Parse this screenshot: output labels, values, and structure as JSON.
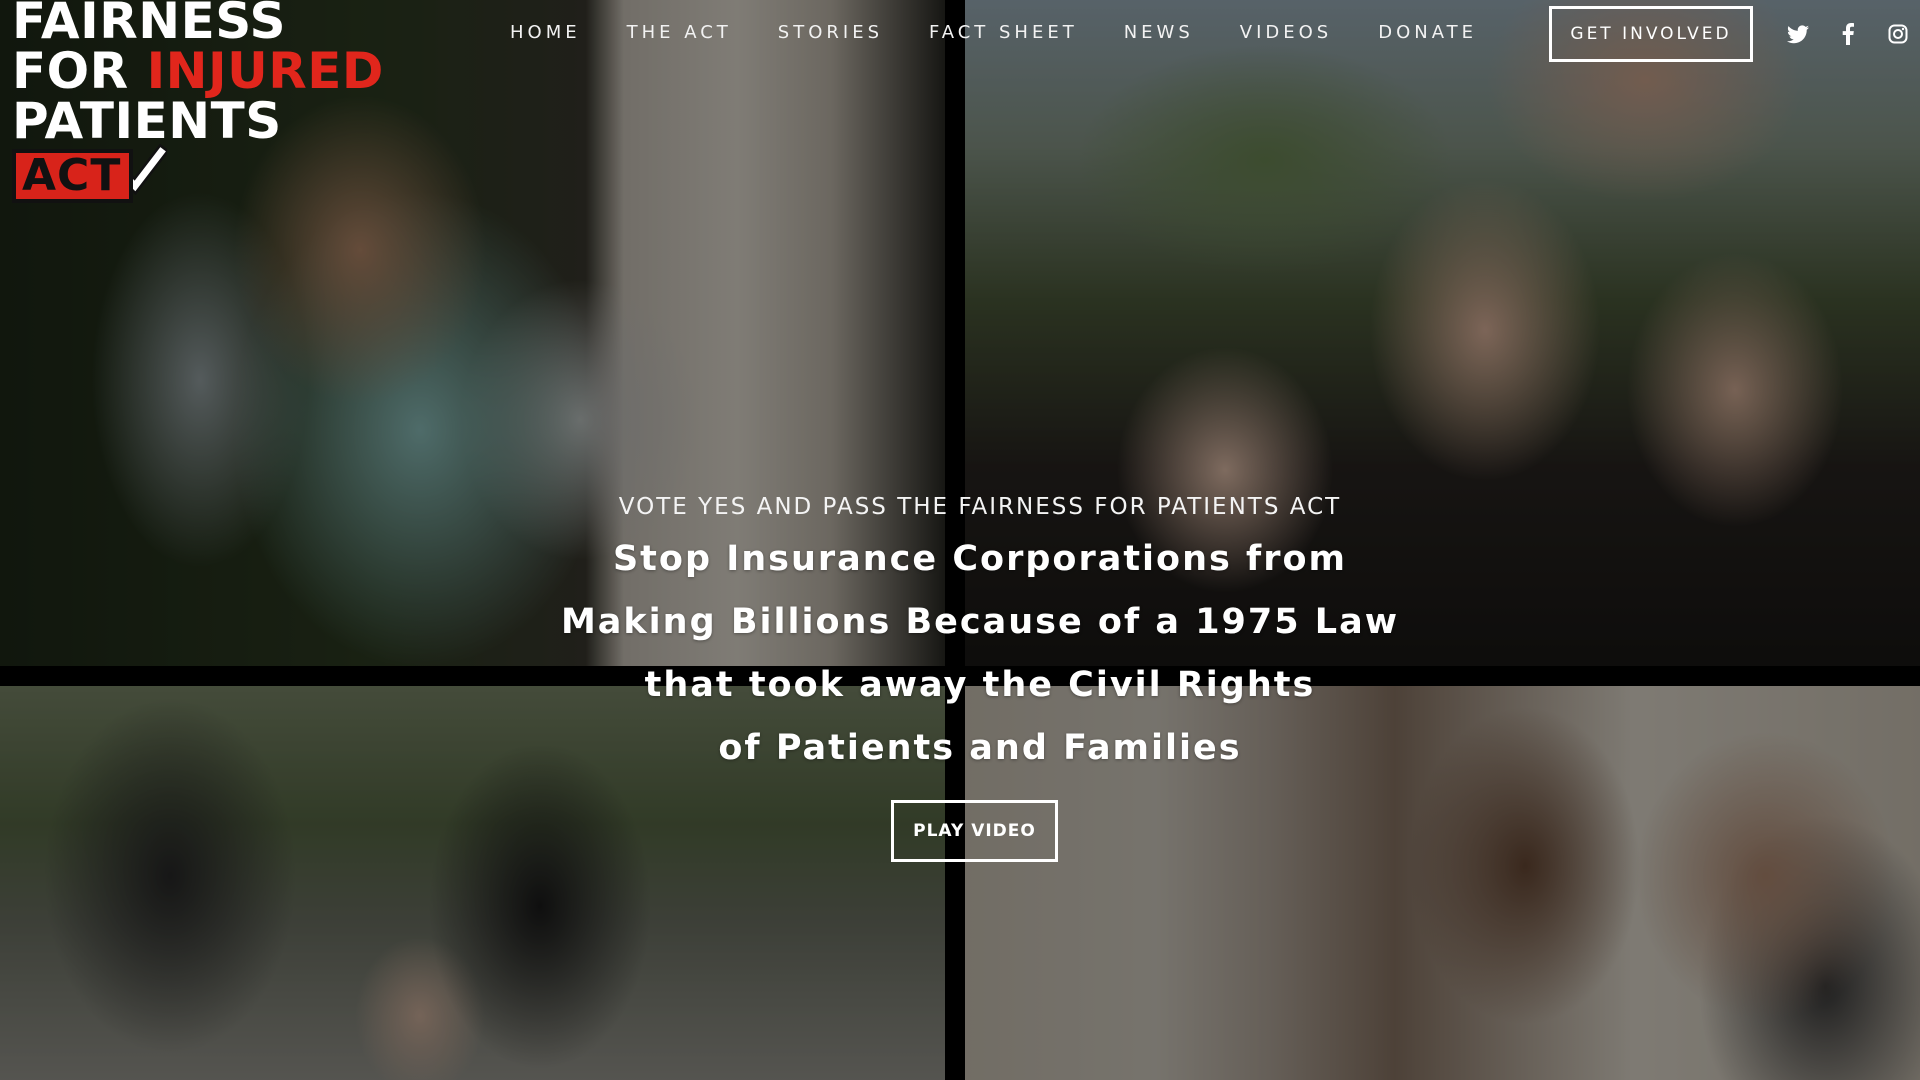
{
  "logo": {
    "line1": "FAIRNESS",
    "line2_white": "FOR ",
    "line2_red": "INJURED",
    "line3": "PATIENTS",
    "line4": "ACT",
    "check_icon": "checkmark-icon",
    "colors": {
      "red": "#e1261c",
      "white": "#ffffff",
      "dark": "#111111"
    }
  },
  "nav": {
    "items": [
      {
        "label": "HOME"
      },
      {
        "label": "THE ACT"
      },
      {
        "label": "STORIES"
      },
      {
        "label": "FACT SHEET"
      },
      {
        "label": "NEWS"
      },
      {
        "label": "VIDEOS"
      },
      {
        "label": "DONATE"
      }
    ],
    "cta_label": "GET INVOLVED"
  },
  "social": {
    "icons": [
      "twitter-icon",
      "facebook-icon",
      "instagram-icon"
    ]
  },
  "hero": {
    "kicker": "VOTE YES AND PASS THE FAIRNESS FOR PATIENTS ACT",
    "headline_lines": [
      "Stop Insurance Corporations from",
      "Making Billions Because of a 1975 Law",
      "that took away the Civil Rights",
      "of Patients and Families"
    ],
    "button_label": "PLAY VIDEO"
  }
}
